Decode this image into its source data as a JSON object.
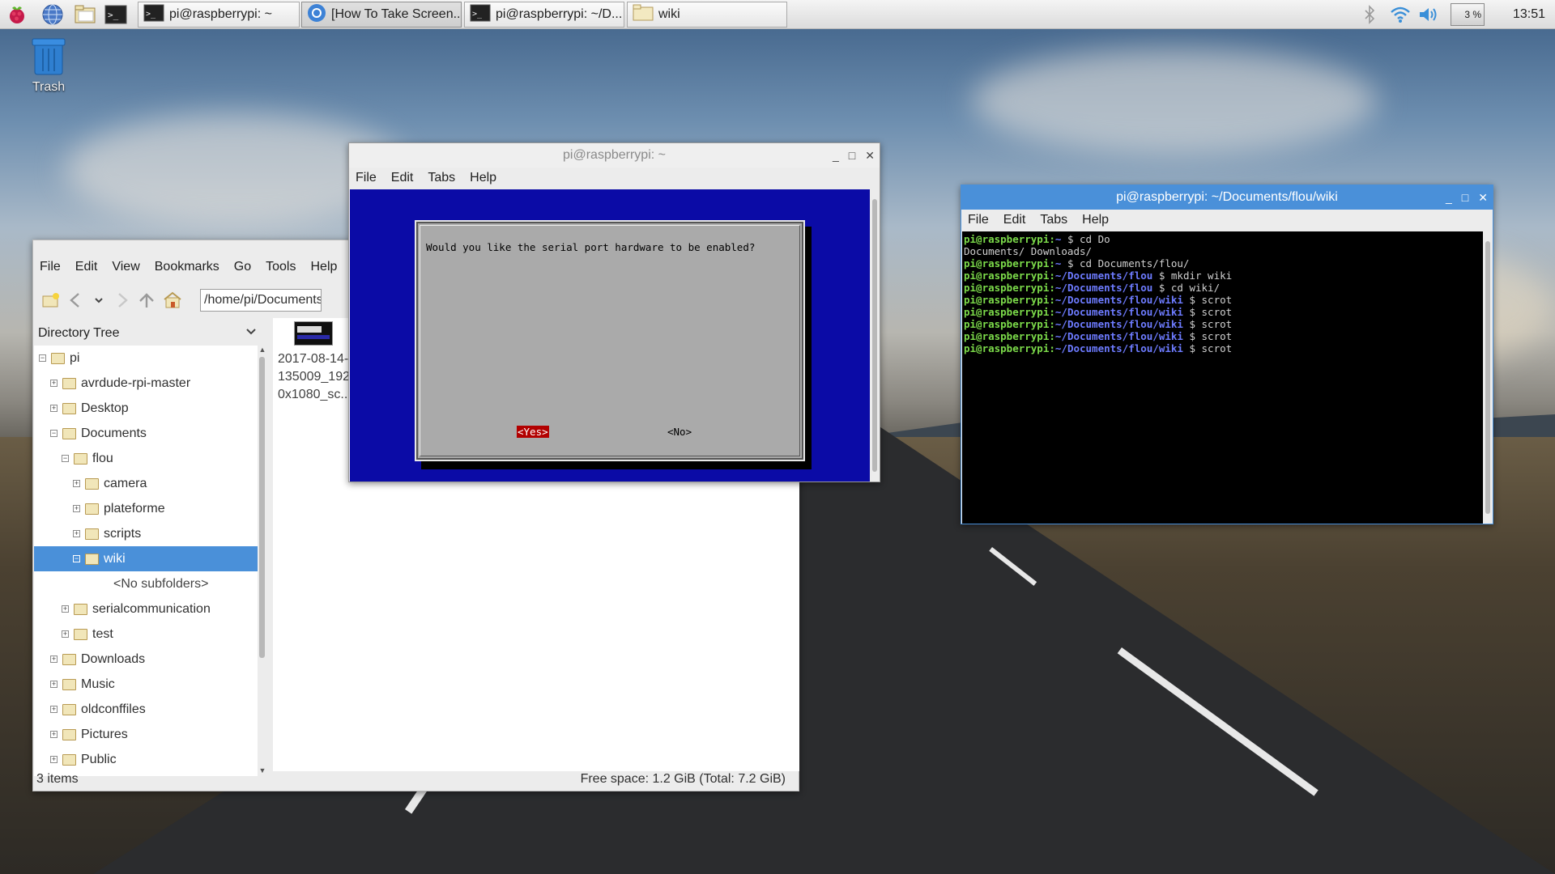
{
  "taskbar": {
    "tasks": [
      {
        "label": "pi@raspberrypi: ~",
        "icon": "terminal-icon"
      },
      {
        "label": "[How To Take Screen...",
        "icon": "chromium-icon"
      },
      {
        "label": "pi@raspberrypi: ~/D...",
        "icon": "terminal-icon"
      },
      {
        "label": "wiki",
        "icon": "folder-icon"
      }
    ],
    "cpu_label": "3 %",
    "clock": "13:51"
  },
  "desktop": {
    "trash_label": "Trash"
  },
  "dialog_window": {
    "title": "pi@raspberrypi: ~",
    "menu": [
      "File",
      "Edit",
      "Tabs",
      "Help"
    ],
    "question": "Would you like the serial port hardware to be enabled?",
    "yes_label": "<Yes>",
    "no_label": "<No>"
  },
  "terminal_window": {
    "title": "pi@raspberrypi: ~/Documents/flou/wiki",
    "menu": [
      "File",
      "Edit",
      "Tabs",
      "Help"
    ],
    "lines": [
      {
        "user": "pi@raspberrypi",
        "path": "~",
        "cmd": " $ cd Do"
      },
      {
        "output": "Documents/ Downloads/"
      },
      {
        "user": "pi@raspberrypi",
        "path": "~",
        "cmd": " $ cd Documents/flou/"
      },
      {
        "user": "pi@raspberrypi",
        "path": "~/Documents/flou",
        "cmd": " $ mkdir wiki"
      },
      {
        "user": "pi@raspberrypi",
        "path": "~/Documents/flou",
        "cmd": " $ cd wiki/"
      },
      {
        "user": "pi@raspberrypi",
        "path": "~/Documents/flou/wiki",
        "cmd": " $ scrot"
      },
      {
        "user": "pi@raspberrypi",
        "path": "~/Documents/flou/wiki",
        "cmd": " $ scrot"
      },
      {
        "user": "pi@raspberrypi",
        "path": "~/Documents/flou/wiki",
        "cmd": " $ scrot"
      },
      {
        "user": "pi@raspberrypi",
        "path": "~/Documents/flou/wiki",
        "cmd": " $ scrot"
      },
      {
        "user": "pi@raspberrypi",
        "path": "~/Documents/flou/wiki",
        "cmd": " $ scrot"
      }
    ]
  },
  "file_manager": {
    "menu": [
      "File",
      "Edit",
      "View",
      "Bookmarks",
      "Go",
      "Tools",
      "Help"
    ],
    "path": "/home/pi/Documents/flou/wiki",
    "sidebar_header": "Directory Tree",
    "tree": [
      {
        "label": "pi",
        "expander": "−",
        "depth": 0
      },
      {
        "label": "avrdude-rpi-master",
        "expander": "+",
        "depth": 1
      },
      {
        "label": "Desktop",
        "expander": "+",
        "depth": 1
      },
      {
        "label": "Documents",
        "expander": "−",
        "depth": 1
      },
      {
        "label": "flou",
        "expander": "−",
        "depth": 2
      },
      {
        "label": "camera",
        "expander": "+",
        "depth": 3
      },
      {
        "label": "plateforme",
        "expander": "+",
        "depth": 3
      },
      {
        "label": "scripts",
        "expander": "+",
        "depth": 3
      },
      {
        "label": "wiki",
        "expander": "−",
        "depth": 3,
        "selected": true
      },
      {
        "label": "<No subfolders>",
        "expander": "",
        "depth": 4,
        "placeholder": true
      },
      {
        "label": "serialcommunication",
        "expander": "+",
        "depth": 2
      },
      {
        "label": "test",
        "expander": "+",
        "depth": 2
      },
      {
        "label": "Downloads",
        "expander": "+",
        "depth": 1
      },
      {
        "label": "Music",
        "expander": "+",
        "depth": 1
      },
      {
        "label": "oldconffiles",
        "expander": "+",
        "depth": 1
      },
      {
        "label": "Pictures",
        "expander": "+",
        "depth": 1
      },
      {
        "label": "Public",
        "expander": "+",
        "depth": 1
      }
    ],
    "file_item": {
      "name_lines": [
        "2017-08-14-",
        "135009_192",
        "0x1080_sc..."
      ]
    },
    "status_left": "3 items",
    "status_right": "Free space: 1.2 GiB (Total: 7.2 GiB)"
  }
}
